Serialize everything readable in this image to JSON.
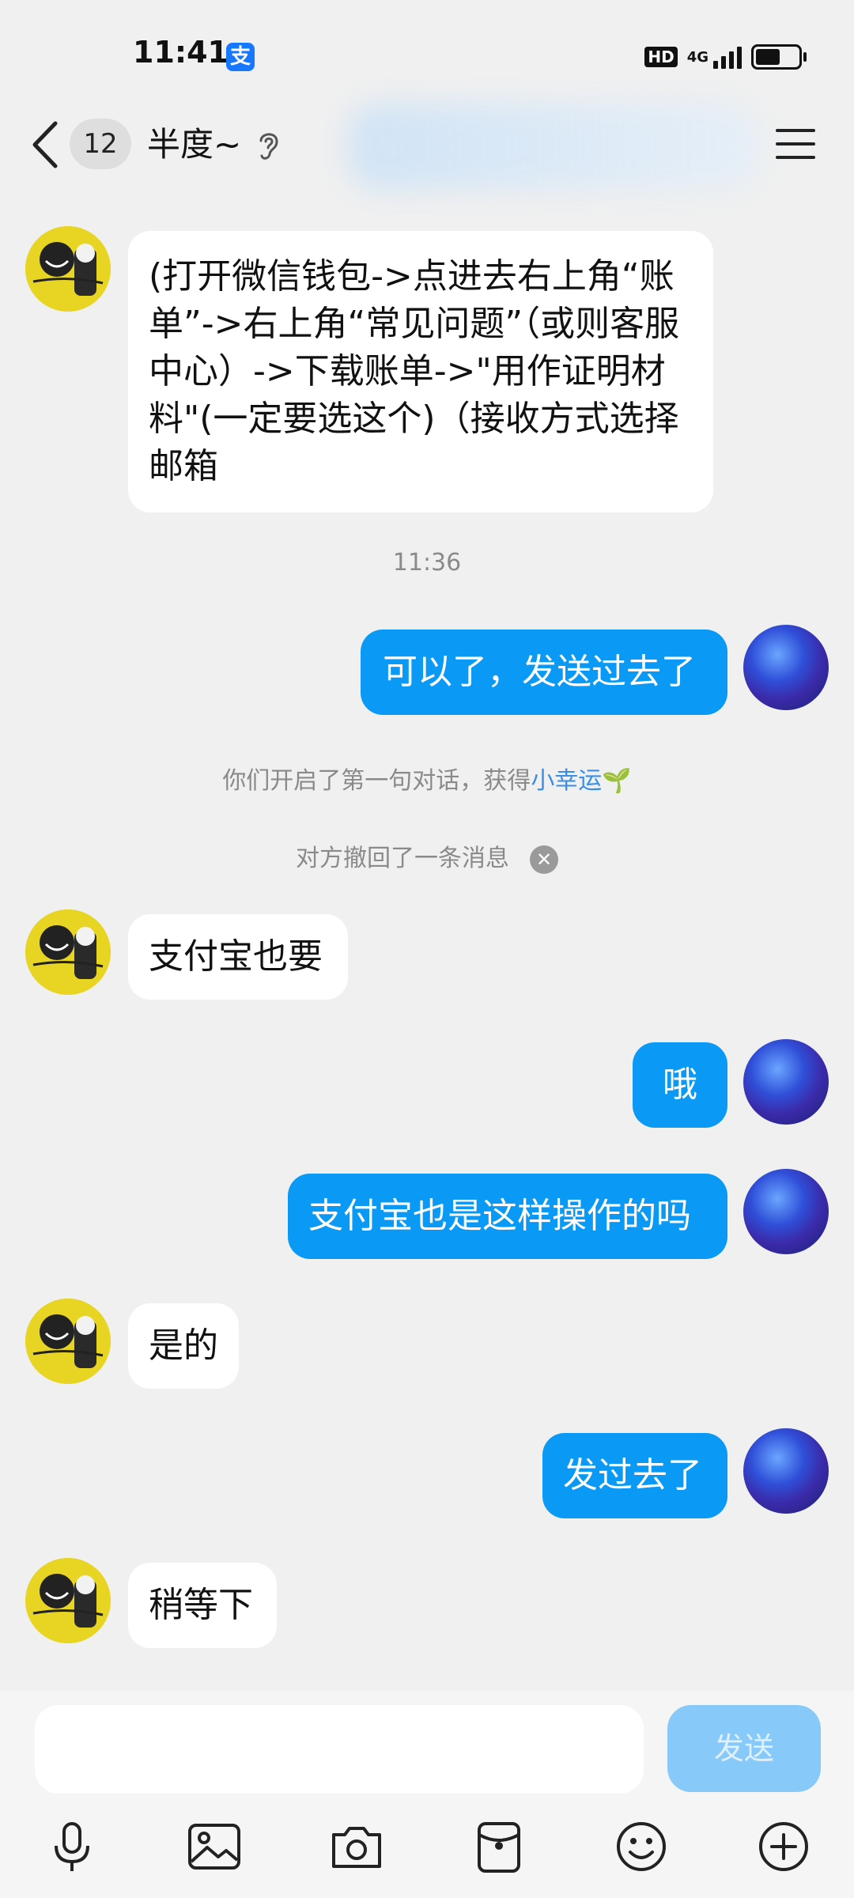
{
  "status_bar": {
    "time": "11:41",
    "app_badge": "支",
    "hd": "HD",
    "network": "4G",
    "signal_level": 4,
    "battery_level": 0.55
  },
  "header": {
    "unread_count": "12",
    "contact_name": "半度~",
    "icons": [
      "back-icon",
      "ear-icon",
      "menu-icon"
    ]
  },
  "messages": [
    {
      "side": "left",
      "text": "(打开微信钱包->点进去右上角“账单”->右上角“常见问题”（或则客服中心）->下载账单->\"用作证明材料\"(一定要选这个)（接收方式选择邮箱"
    },
    {
      "side": "time",
      "text": "11:36"
    },
    {
      "side": "right",
      "text": "可以了，发送过去了"
    },
    {
      "side": "system",
      "text": "你们开启了第一句对话，获得",
      "link": "小幸运",
      "emoji": "🌱"
    },
    {
      "side": "system",
      "text": "对方撤回了一条消息"
    },
    {
      "side": "left",
      "text": "支付宝也要"
    },
    {
      "side": "right",
      "text": "哦"
    },
    {
      "side": "right",
      "text": "支付宝也是这样操作的吗"
    },
    {
      "side": "left",
      "text": "是的"
    },
    {
      "side": "right",
      "text": "发过去了"
    },
    {
      "side": "left",
      "text": "稍等下"
    }
  ],
  "input_bar": {
    "placeholder": "",
    "send_label": "发送",
    "tools": [
      "microphone-icon",
      "image-icon",
      "camera-icon",
      "red-packet-icon",
      "emoji-icon",
      "plus-icon"
    ]
  },
  "colors": {
    "background": "#f0f0f0",
    "outgoing_bubble": "#0a99f5",
    "incoming_bubble": "#ffffff",
    "send_button_disabled": "#87c9f8",
    "link": "#3a8ee6"
  }
}
